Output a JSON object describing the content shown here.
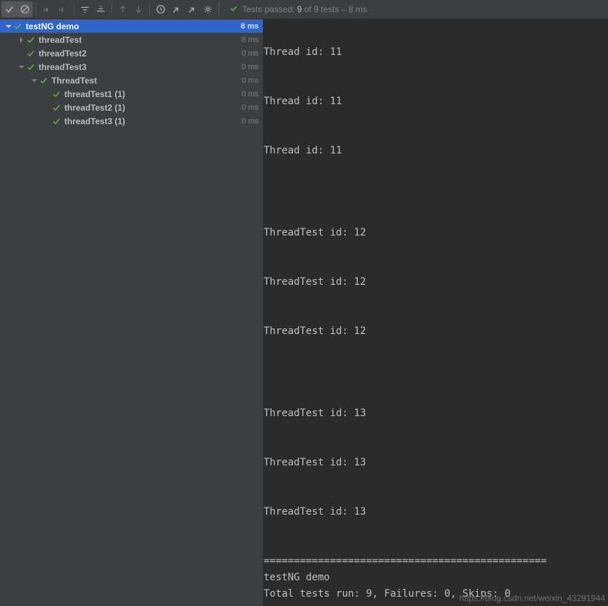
{
  "toolbar": {
    "status_prefix": "Tests passed:",
    "passed": "9",
    "total": "of 9 tests",
    "duration": "– 8 ms"
  },
  "tree": [
    {
      "depth": 0,
      "arrow": "down",
      "icon": "check",
      "label": "testNG demo",
      "time": "8 ms",
      "selected": true
    },
    {
      "depth": 1,
      "arrow": "right",
      "icon": "check",
      "label": "threadTest",
      "time": "8 ms"
    },
    {
      "depth": 1,
      "arrow": "none",
      "icon": "check",
      "label": "threadTest2",
      "time": "0 ms"
    },
    {
      "depth": 1,
      "arrow": "down",
      "icon": "check",
      "label": "threadTest3",
      "time": "0 ms"
    },
    {
      "depth": 2,
      "arrow": "down",
      "icon": "check",
      "label": "ThreadTest",
      "time": "0 ms"
    },
    {
      "depth": 3,
      "arrow": "none",
      "icon": "check",
      "label": "threadTest1 (1)",
      "time": "0 ms"
    },
    {
      "depth": 3,
      "arrow": "none",
      "icon": "check",
      "label": "threadTest2 (1)",
      "time": "0 ms"
    },
    {
      "depth": 3,
      "arrow": "none",
      "icon": "check",
      "label": "threadTest3 (1)",
      "time": "0 ms"
    }
  ],
  "console_lines": [
    "",
    "Thread id: 11",
    "",
    "",
    "Thread id: 11",
    "",
    "",
    "Thread id: 11",
    "",
    "",
    "",
    "",
    "ThreadTest id: 12",
    "",
    "",
    "ThreadTest id: 12",
    "",
    "",
    "ThreadTest id: 12",
    "",
    "",
    "",
    "",
    "ThreadTest id: 13",
    "",
    "",
    "ThreadTest id: 13",
    "",
    "",
    "ThreadTest id: 13",
    "",
    "",
    "===============================================",
    "testNG demo",
    "Total tests run: 9, Failures: 0, Skips: 0",
    "==============================================="
  ],
  "watermark": "https://blog.csdn.net/weixin_43291944"
}
